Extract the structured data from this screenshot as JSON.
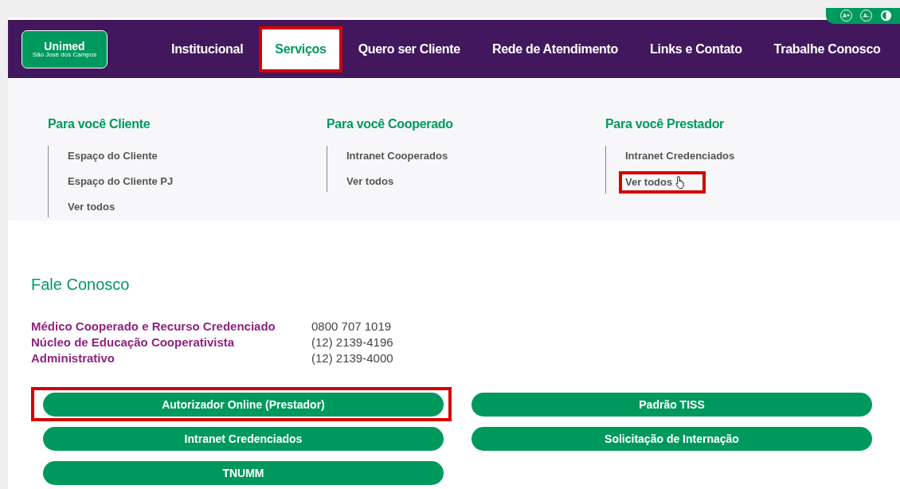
{
  "header": {
    "logo": {
      "name": "Unimed",
      "subtitle": "São José dos Campos"
    },
    "accessibility": [
      {
        "kind": "text",
        "label": "A+"
      },
      {
        "kind": "text",
        "label": "A-"
      },
      {
        "kind": "contrast"
      }
    ],
    "nav": [
      {
        "label": "Institucional",
        "selected": false,
        "highlighted": false
      },
      {
        "label": "Serviços",
        "selected": true,
        "highlighted": true
      },
      {
        "label": "Quero ser Cliente",
        "selected": false,
        "highlighted": false
      },
      {
        "label": "Rede de Atendimento",
        "selected": false,
        "highlighted": false
      },
      {
        "label": "Links e Contato",
        "selected": false,
        "highlighted": false
      },
      {
        "label": "Trabalhe Conosco",
        "selected": false,
        "highlighted": false
      }
    ]
  },
  "menu": [
    {
      "title": "Para você Cliente",
      "links": [
        {
          "label": "Espaço do Cliente",
          "highlighted": false,
          "hovered": false
        },
        {
          "label": "Espaço do Cliente PJ",
          "highlighted": false,
          "hovered": false
        },
        {
          "label": "Ver todos",
          "highlighted": false,
          "hovered": false
        }
      ]
    },
    {
      "title": "Para você Cooperado",
      "links": [
        {
          "label": "Intranet Cooperados",
          "highlighted": false,
          "hovered": false
        },
        {
          "label": "Ver todos",
          "highlighted": false,
          "hovered": false
        }
      ]
    },
    {
      "title": "Para você Prestador",
      "links": [
        {
          "label": "Intranet Credenciados",
          "highlighted": false,
          "hovered": false
        },
        {
          "label": "Ver todos",
          "highlighted": true,
          "hovered": true
        }
      ]
    }
  ],
  "contact": {
    "title": "Fale Conosco",
    "rows": [
      {
        "label": "Médico Cooperado e Recurso Credenciado",
        "phone": "0800 707 1019"
      },
      {
        "label": "Núcleo de Educação Cooperativista",
        "phone": "(12) 2139-4196"
      },
      {
        "label": "Administrativo",
        "phone": "(12) 2139-4000"
      }
    ]
  },
  "buttons": [
    {
      "label": "Autorizador Online (Prestador)",
      "highlighted": true
    },
    {
      "label": "Padrão TISS",
      "highlighted": false
    },
    {
      "label": "Intranet Credenciados",
      "highlighted": false
    },
    {
      "label": "Solicitação de Internação",
      "highlighted": false
    },
    {
      "label": "TNUMM",
      "highlighted": false
    }
  ]
}
